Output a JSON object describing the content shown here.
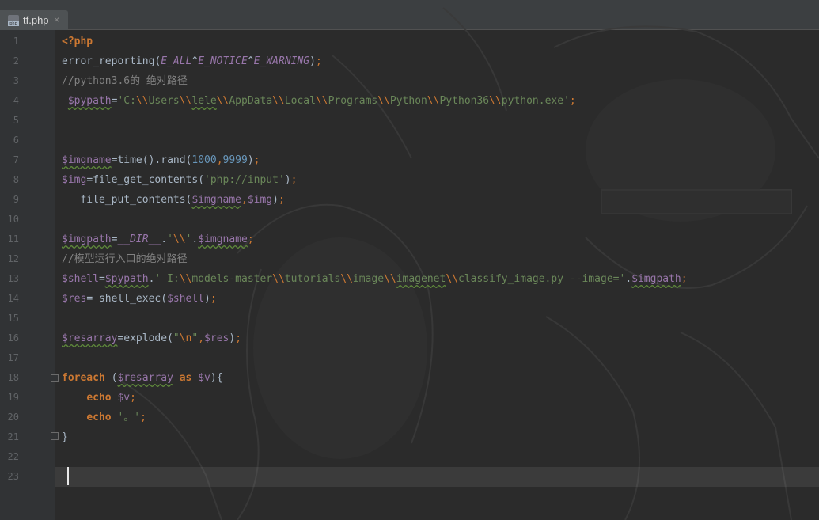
{
  "tab": {
    "filename": "tf.php",
    "close_glyph": "×",
    "icon": "php-file-icon"
  },
  "lines": [
    {
      "n": "1"
    },
    {
      "n": "2"
    },
    {
      "n": "3"
    },
    {
      "n": "4"
    },
    {
      "n": "5"
    },
    {
      "n": "6"
    },
    {
      "n": "7"
    },
    {
      "n": "8"
    },
    {
      "n": "9"
    },
    {
      "n": "10"
    },
    {
      "n": "11"
    },
    {
      "n": "12"
    },
    {
      "n": "13"
    },
    {
      "n": "14"
    },
    {
      "n": "15"
    },
    {
      "n": "16"
    },
    {
      "n": "17"
    },
    {
      "n": "18"
    },
    {
      "n": "19"
    },
    {
      "n": "20"
    },
    {
      "n": "21"
    },
    {
      "n": "22"
    },
    {
      "n": "23"
    }
  ],
  "code": {
    "l1": [
      {
        "c": "tag",
        "t": "<?php"
      }
    ],
    "l2": [
      {
        "c": "fn",
        "t": "error_reporting("
      },
      {
        "c": "const",
        "t": "E_ALL"
      },
      {
        "c": "fn",
        "t": "^"
      },
      {
        "c": "const",
        "t": "E_NOTICE"
      },
      {
        "c": "fn",
        "t": "^"
      },
      {
        "c": "const",
        "t": "E_WARNING"
      },
      {
        "c": "fn",
        "t": ")"
      },
      {
        "c": "pun",
        "t": ";"
      }
    ],
    "l3": [
      {
        "c": "cmt",
        "t": "//python3.6的 绝对路径"
      }
    ],
    "l4": [
      {
        "c": "fn",
        "t": " "
      },
      {
        "c": "varu",
        "t": "$pypath"
      },
      {
        "c": "fn",
        "t": "="
      },
      {
        "c": "str",
        "t": "'C:"
      },
      {
        "c": "esc",
        "t": "\\\\"
      },
      {
        "c": "str",
        "t": "Users"
      },
      {
        "c": "esc",
        "t": "\\\\"
      },
      {
        "c": "str u",
        "t": "lele"
      },
      {
        "c": "esc",
        "t": "\\\\"
      },
      {
        "c": "str",
        "t": "AppData"
      },
      {
        "c": "esc",
        "t": "\\\\"
      },
      {
        "c": "str",
        "t": "Local"
      },
      {
        "c": "esc",
        "t": "\\\\"
      },
      {
        "c": "str",
        "t": "Programs"
      },
      {
        "c": "esc",
        "t": "\\\\"
      },
      {
        "c": "str",
        "t": "Python"
      },
      {
        "c": "esc",
        "t": "\\\\"
      },
      {
        "c": "str",
        "t": "Python36"
      },
      {
        "c": "esc",
        "t": "\\\\"
      },
      {
        "c": "str",
        "t": "python.exe'"
      },
      {
        "c": "pun",
        "t": ";"
      }
    ],
    "l5": [],
    "l6": [],
    "l7": [
      {
        "c": "varu",
        "t": "$imgname"
      },
      {
        "c": "fn",
        "t": "=time()."
      },
      {
        "c": "fn",
        "t": "rand("
      },
      {
        "c": "num",
        "t": "1000"
      },
      {
        "c": "pun",
        "t": ","
      },
      {
        "c": "num",
        "t": "9999"
      },
      {
        "c": "fn",
        "t": ")"
      },
      {
        "c": "pun",
        "t": ";"
      }
    ],
    "l8": [
      {
        "c": "var",
        "t": "$img"
      },
      {
        "c": "fn",
        "t": "=file_get_contents("
      },
      {
        "c": "str",
        "t": "'php://input'"
      },
      {
        "c": "fn",
        "t": ")"
      },
      {
        "c": "pun",
        "t": ";"
      }
    ],
    "l9": [
      {
        "c": "fn",
        "t": "   file_put_contents("
      },
      {
        "c": "varu",
        "t": "$imgname"
      },
      {
        "c": "pun",
        "t": ","
      },
      {
        "c": "var",
        "t": "$img"
      },
      {
        "c": "fn",
        "t": ")"
      },
      {
        "c": "pun",
        "t": ";"
      }
    ],
    "l10": [],
    "l11": [
      {
        "c": "varu",
        "t": "$imgpath"
      },
      {
        "c": "fn",
        "t": "="
      },
      {
        "c": "const",
        "t": "__DIR__"
      },
      {
        "c": "fn",
        "t": "."
      },
      {
        "c": "str",
        "t": "'"
      },
      {
        "c": "esc",
        "t": "\\\\"
      },
      {
        "c": "str",
        "t": "'"
      },
      {
        "c": "fn",
        "t": "."
      },
      {
        "c": "varu",
        "t": "$imgname"
      },
      {
        "c": "pun",
        "t": ";"
      }
    ],
    "l12": [
      {
        "c": "cmt",
        "t": "//模型运行入口的绝对路径"
      }
    ],
    "l13": [
      {
        "c": "var",
        "t": "$shell"
      },
      {
        "c": "fn",
        "t": "="
      },
      {
        "c": "varu",
        "t": "$pypath"
      },
      {
        "c": "fn",
        "t": "."
      },
      {
        "c": "str",
        "t": "' I:"
      },
      {
        "c": "esc",
        "t": "\\\\"
      },
      {
        "c": "str",
        "t": "models-master"
      },
      {
        "c": "esc",
        "t": "\\\\"
      },
      {
        "c": "str",
        "t": "tutorials"
      },
      {
        "c": "esc",
        "t": "\\\\"
      },
      {
        "c": "str",
        "t": "image"
      },
      {
        "c": "esc",
        "t": "\\\\"
      },
      {
        "c": "str u",
        "t": "imagenet"
      },
      {
        "c": "esc",
        "t": "\\\\"
      },
      {
        "c": "str",
        "t": "classify_image.py --image='"
      },
      {
        "c": "fn",
        "t": "."
      },
      {
        "c": "varu",
        "t": "$imgpath"
      },
      {
        "c": "pun",
        "t": ";"
      }
    ],
    "l14": [
      {
        "c": "var",
        "t": "$res"
      },
      {
        "c": "fn",
        "t": "= shell_exec("
      },
      {
        "c": "var",
        "t": "$shell"
      },
      {
        "c": "fn",
        "t": ")"
      },
      {
        "c": "pun",
        "t": ";"
      }
    ],
    "l15": [],
    "l16": [
      {
        "c": "varu",
        "t": "$resarray"
      },
      {
        "c": "fn",
        "t": "=explode("
      },
      {
        "c": "str",
        "t": "\""
      },
      {
        "c": "esc",
        "t": "\\n"
      },
      {
        "c": "str",
        "t": "\""
      },
      {
        "c": "pun",
        "t": ","
      },
      {
        "c": "var",
        "t": "$res"
      },
      {
        "c": "fn",
        "t": ")"
      },
      {
        "c": "pun",
        "t": ";"
      }
    ],
    "l17": [],
    "l18": [
      {
        "c": "kw",
        "t": "foreach"
      },
      {
        "c": "fn",
        "t": " ("
      },
      {
        "c": "varu",
        "t": "$resarray"
      },
      {
        "c": "fn",
        "t": " "
      },
      {
        "c": "kw",
        "t": "as"
      },
      {
        "c": "fn",
        "t": " "
      },
      {
        "c": "var",
        "t": "$v"
      },
      {
        "c": "fn",
        "t": "){"
      }
    ],
    "l19": [
      {
        "c": "fn",
        "t": "    "
      },
      {
        "c": "kw",
        "t": "echo"
      },
      {
        "c": "fn",
        "t": " "
      },
      {
        "c": "var",
        "t": "$v"
      },
      {
        "c": "pun",
        "t": ";"
      }
    ],
    "l20": [
      {
        "c": "fn",
        "t": "    "
      },
      {
        "c": "kw",
        "t": "echo"
      },
      {
        "c": "fn",
        "t": " "
      },
      {
        "c": "str",
        "t": "'。'"
      },
      {
        "c": "pun",
        "t": ";"
      }
    ],
    "l21": [
      {
        "c": "fn",
        "t": "}"
      }
    ],
    "l22": [],
    "l23": []
  },
  "colors": {
    "background": "#2b2b2b",
    "keyword": "#cc7832",
    "variable": "#9876aa",
    "string": "#6a8759",
    "number": "#6897bb",
    "comment": "#808080",
    "default": "#a9b7c6"
  }
}
